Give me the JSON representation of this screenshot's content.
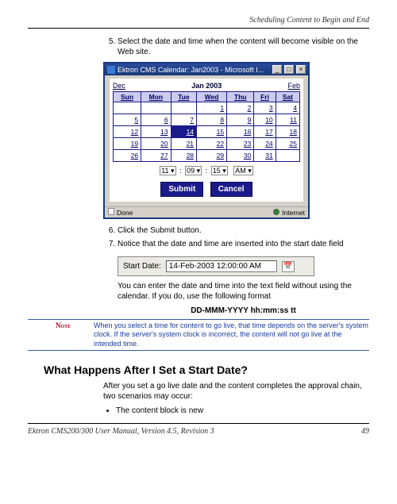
{
  "header": {
    "running_title": "Scheduling Content to Begin and End"
  },
  "steps": {
    "start_index": 5,
    "s5": "Select the date and time when the content will become visible on the Web site.",
    "s6": "Click the Submit button.",
    "s7": "Notice that the date and time are inserted into the start date field"
  },
  "calendar": {
    "window_title": "Ektron CMS Calendar: Jan2003 - Microsoft I...",
    "prev_month": "Dec",
    "next_month": "Feb",
    "month_title": "Jan  2003",
    "days": [
      "Sun",
      "Mon",
      "Tue",
      "Wed",
      "Thu",
      "Fri",
      "Sat"
    ],
    "weeks": [
      [
        "",
        "",
        "",
        "1",
        "2",
        "3",
        "4"
      ],
      [
        "5",
        "6",
        "7",
        "8",
        "9",
        "10",
        "11"
      ],
      [
        "12",
        "13",
        "14",
        "15",
        "16",
        "17",
        "18"
      ],
      [
        "19",
        "20",
        "21",
        "22",
        "23",
        "24",
        "25"
      ],
      [
        "26",
        "27",
        "28",
        "29",
        "30",
        "31",
        ""
      ]
    ],
    "today": "14",
    "time": {
      "hour": "11",
      "minute": "09",
      "second": "15",
      "ampm": "AM"
    },
    "submit_label": "Submit",
    "cancel_label": "Cancel",
    "status_left": "Done",
    "status_right": "Internet"
  },
  "start_date_field": {
    "label": "Start Date:",
    "value": "14-Feb-2003 12:00:00 AM"
  },
  "body": {
    "after_field": "You can enter the date and time into the text field without using the calendar. If you do, use the following format",
    "format": "DD-MMM-YYYY hh:mm:ss tt",
    "note_label": "Note",
    "note_text": "When you select a time for content to go live, that time depends on the server's system clock. If the server's system clock is incorrect, the content will not go live at the intended time.",
    "section_heading": "What Happens After I Set a Start Date?",
    "section_para": "After you set a go live date and the content completes the approval chain, two scenarios may occur:",
    "bullet1": "The content block is new"
  },
  "footer": {
    "left": "Ektron CMS200/300 User Manual, Version 4.5, Revision 3",
    "right": "49"
  }
}
